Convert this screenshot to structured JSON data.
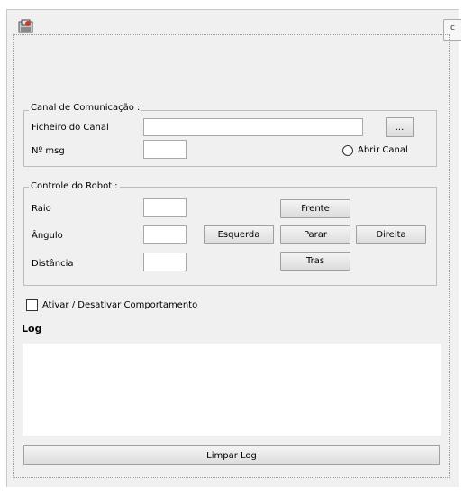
{
  "window": {
    "icon": "app-icon",
    "tab_stub_text": "c"
  },
  "channel": {
    "legend": "Canal de Comunicação :",
    "file_label": "Ficheiro do Canal",
    "file_value": "",
    "browse_label": "...",
    "msg_label": "Nº msg",
    "msg_value": "",
    "open_channel_label": "Abrir Canal",
    "open_channel_checked": false
  },
  "robot": {
    "legend": "Controle do Robot :",
    "radius_label": "Raio",
    "radius_value": "",
    "angle_label": "Ângulo",
    "angle_value": "",
    "distance_label": "Distância",
    "distance_value": "",
    "forward_label": "Frente",
    "left_label": "Esquerda",
    "stop_label": "Parar",
    "right_label": "Direita",
    "back_label": "Tras"
  },
  "behavior": {
    "toggle_label": "Ativar / Desativar Comportamento",
    "checked": false
  },
  "log": {
    "title": "Log",
    "content": "",
    "clear_label": "Limpar Log"
  }
}
